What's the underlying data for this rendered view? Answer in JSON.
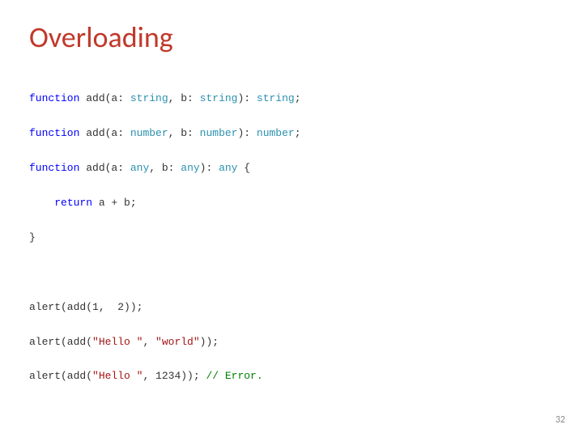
{
  "title": "Overloading",
  "code": {
    "l1": {
      "kw": "function",
      "name": " add(a: ",
      "t1": "string",
      "s1": ", b: ",
      "t2": "string",
      "s2": "): ",
      "t3": "string",
      "end": ";"
    },
    "l2": {
      "kw": "function",
      "name": " add(a: ",
      "t1": "number",
      "s1": ", b: ",
      "t2": "number",
      "s2": "): ",
      "t3": "number",
      "end": ";"
    },
    "l3": {
      "kw": "function",
      "name": " add(a: ",
      "t1": "any",
      "s1": ", b: ",
      "t2": "any",
      "s2": "): ",
      "t3": "any",
      "end": " {"
    },
    "l4": {
      "indent": "    ",
      "kw": "return",
      "rest": " a + b;"
    },
    "l5": "}",
    "l6": "",
    "l7": "alert(add(1,  2));",
    "l8": {
      "pre": "alert(add(",
      "s1": "\"Hello \"",
      "mid": ", ",
      "s2": "\"world\"",
      "post": "));"
    },
    "l9": {
      "pre": "alert(add(",
      "s1": "\"Hello \"",
      "mid": ", 1234)); ",
      "cmt": "// Error."
    }
  },
  "pagenum": "32"
}
